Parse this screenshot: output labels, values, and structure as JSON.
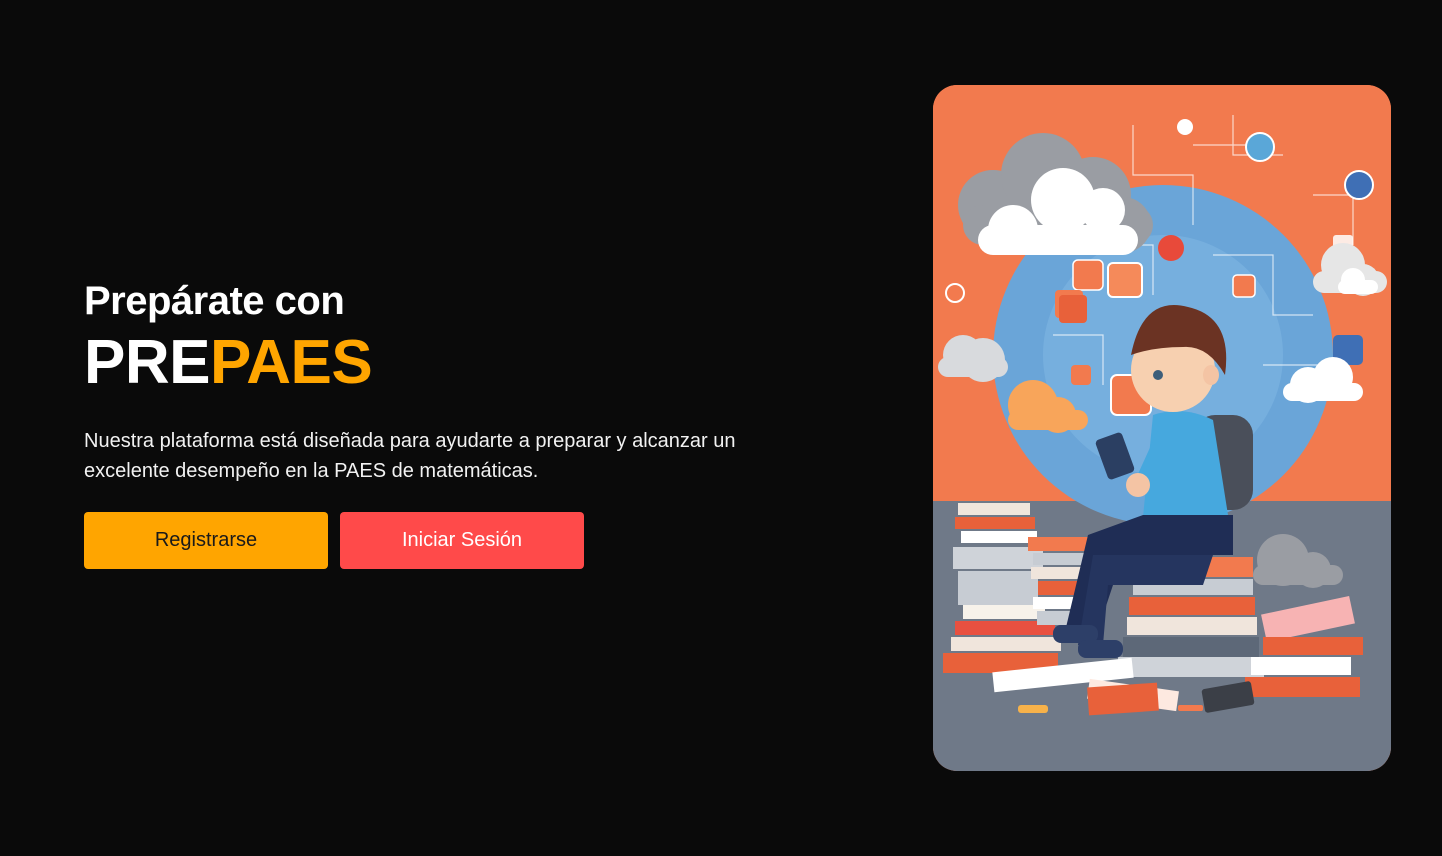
{
  "hero": {
    "kicker": "Prepárate con",
    "brand_part1": "PRE",
    "brand_part2": "PAES",
    "description": "Nuestra plataforma está diseñada para ayudarte a preparar y alcanzar un excelente desempeño en la PAES de matemáticas."
  },
  "actions": {
    "register_label": "Registrarse",
    "login_label": "Iniciar Sesión"
  },
  "colors": {
    "background": "#0a0a0a",
    "accent": "#ffa500",
    "login": "#ff4a4a",
    "illustration_top": "#f27a4e",
    "illustration_bottom": "#6f7988"
  }
}
